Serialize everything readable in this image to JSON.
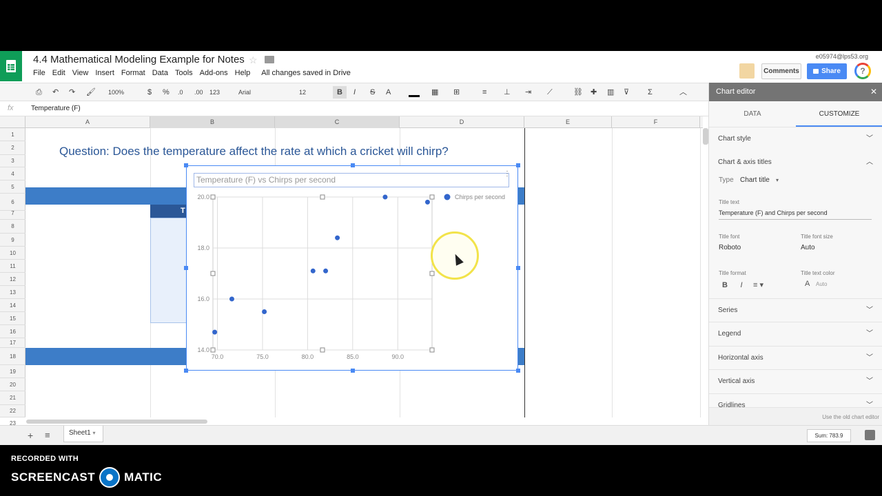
{
  "app": {
    "doc_title": "4.4 Mathematical Modeling Example for Notes",
    "account": "e05974@lps53.org",
    "menu": [
      "File",
      "Edit",
      "View",
      "Insert",
      "Format",
      "Data",
      "Tools",
      "Add-ons",
      "Help"
    ],
    "save_status": "All changes saved in Drive",
    "comments_label": "Comments",
    "share_label": "Share"
  },
  "toolbar": {
    "zoom": "100%",
    "currency": "$",
    "percent": "%",
    "dec_less": ".0",
    "dec_more": ".00",
    "more_formats": "123",
    "font": "Arial",
    "font_size": "12",
    "bold": "B",
    "italic": "I",
    "strike": "S",
    "text_color": "A"
  },
  "formula_bar": {
    "fx": "fx",
    "content": "Temperature (F)"
  },
  "columns": [
    "A",
    "B",
    "C",
    "D",
    "E",
    "F"
  ],
  "rows": [
    "1",
    "2",
    "3",
    "4",
    "5",
    "6",
    "7",
    "8",
    "9",
    "10",
    "11",
    "12",
    "13",
    "14",
    "15",
    "16",
    "17",
    "18",
    "19",
    "20",
    "21",
    "22",
    "23"
  ],
  "sheet": {
    "question": "Question: Does the temperature affect the rate at which a cricket will chirp?",
    "header_cell_fragment": "T"
  },
  "chart_data": {
    "type": "scatter",
    "title": "Temperature (F) vs Chirps per second",
    "series": [
      {
        "name": "Chirps per second",
        "x": [
          69.7,
          71.6,
          75.2,
          80.6,
          82.0,
          83.3,
          88.6,
          93.3
        ],
        "y": [
          14.7,
          16.0,
          15.5,
          17.1,
          17.1,
          18.4,
          20.0,
          19.8
        ]
      }
    ],
    "xlim": [
      69.5,
      93.8
    ],
    "ylim": [
      14.0,
      20.0
    ],
    "x_ticks": [
      "70.0",
      "75.0",
      "80.0",
      "85.0",
      "90.0"
    ],
    "y_ticks": [
      "20.0",
      "18.0",
      "16.0",
      "14.0"
    ],
    "legend_position": "right",
    "grid": true,
    "point_color": "#3366cc"
  },
  "sidebar": {
    "title": "Chart editor",
    "tabs": [
      "DATA",
      "CUSTOMIZE"
    ],
    "sections": {
      "chart_style": "Chart style",
      "chart_axis_titles": "Chart & axis titles",
      "series": "Series",
      "legend": "Legend",
      "horizontal_axis": "Horizontal axis",
      "vertical_axis": "Vertical axis",
      "gridlines": "Gridlines"
    },
    "type_label": "Type",
    "type_value": "Chart title",
    "title_text_label": "Title text",
    "title_text_value": "Temperature (F) and Chirps per second",
    "title_font_label": "Title font",
    "title_font_value": "Roboto",
    "title_font_size_label": "Title font size",
    "title_font_size_value": "Auto",
    "title_format_label": "Title format",
    "title_text_color_label": "Title text color",
    "title_text_color_value": "Auto",
    "old_editor_link": "Use the old chart editor"
  },
  "bottom": {
    "sheet_tab": "Sheet1",
    "sum": "Sum: 783.9"
  },
  "watermark": {
    "line1": "RECORDED WITH",
    "brand_left": "SCREENCAST",
    "brand_right": "MATIC"
  }
}
